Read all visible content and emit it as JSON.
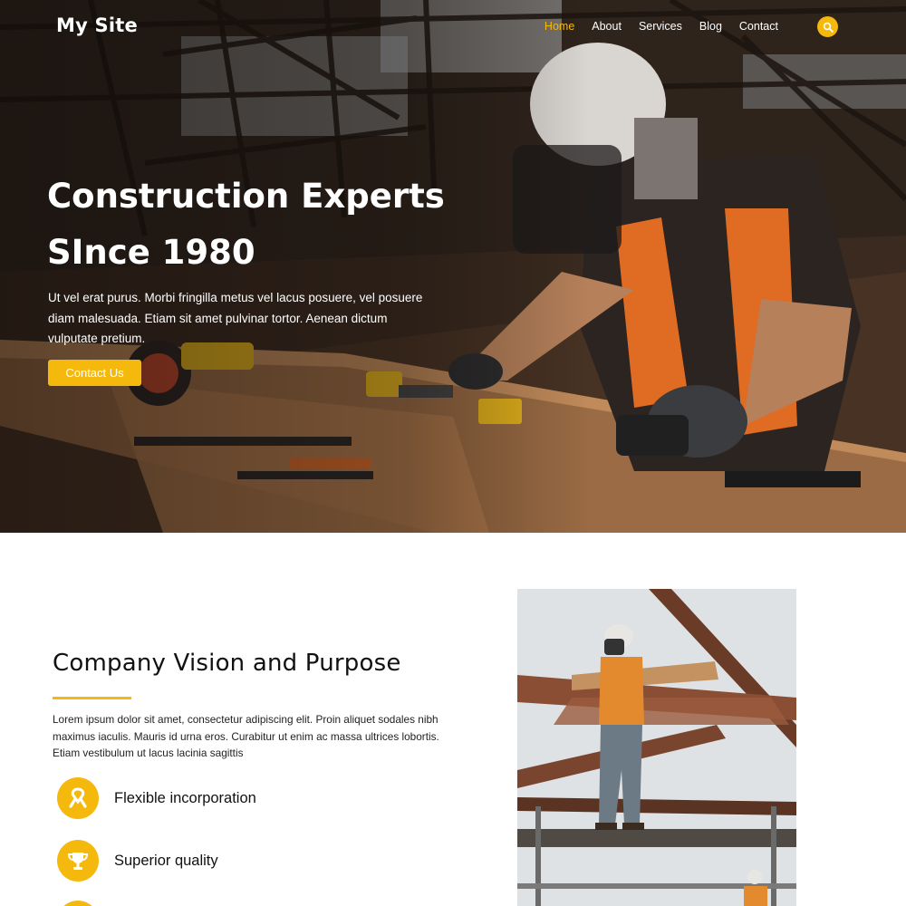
{
  "brand": {
    "name": "My Site",
    "accent": "#f5b90e"
  },
  "nav": {
    "items": [
      {
        "label": "Home",
        "active": true
      },
      {
        "label": "About",
        "active": false
      },
      {
        "label": "Services",
        "active": false
      },
      {
        "label": "Blog",
        "active": false
      },
      {
        "label": "Contact",
        "active": false
      }
    ],
    "search_icon": "search-icon"
  },
  "hero": {
    "title_line1": "Construction Experts",
    "title_line2": "SInce 1980",
    "text": "Ut vel erat purus. Morbi fringilla metus vel lacus posuere, vel posuere diam malesuada. Etiam sit amet pulvinar tortor. Aenean dictum vulputate pretium.",
    "cta_label": "Contact Us"
  },
  "vision": {
    "title": "Company Vision and Purpose",
    "text": "Lorem ipsum dolor sit amet, consectetur adipiscing elit. Proin aliquet sodales nibh maximus iaculis. Mauris id urna eros. Curabitur ut enim ac massa ultrices lobortis. Etiam vestibulum ut lacus lacinia sagittis",
    "features": [
      {
        "label": "Flexible incorporation",
        "icon": "ribbon-icon"
      },
      {
        "label": "Superior quality",
        "icon": "trophy-icon"
      },
      {
        "label": "",
        "icon": "circle-icon"
      }
    ]
  }
}
